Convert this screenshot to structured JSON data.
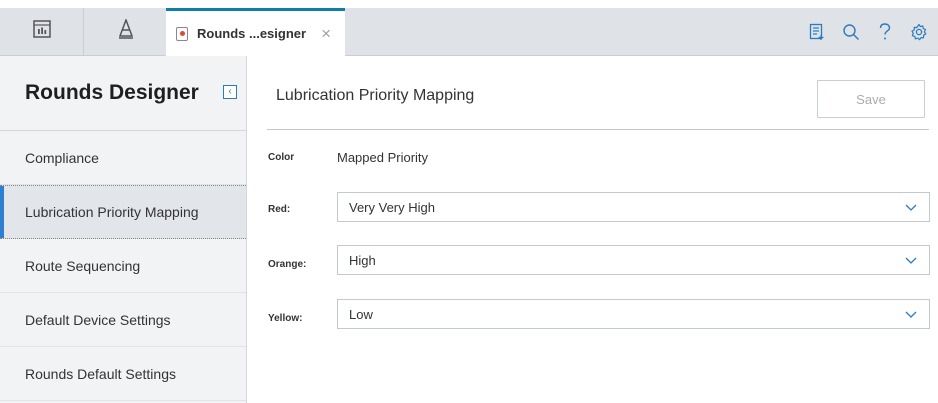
{
  "tabbar": {
    "tabs": [
      {
        "label": "Rounds ...esigner",
        "close": "×"
      }
    ],
    "icons": [
      "dashboard-icon",
      "hierarchy-icon",
      "document-icon",
      "clipboard-icon",
      "search-icon",
      "help-icon",
      "settings-icon"
    ]
  },
  "sidebar": {
    "title": "Rounds Designer",
    "items": [
      {
        "label": "Compliance",
        "active": false
      },
      {
        "label": "Lubrication Priority Mapping",
        "active": true
      },
      {
        "label": "Route Sequencing",
        "active": false
      },
      {
        "label": "Default Device Settings",
        "active": false
      },
      {
        "label": "Rounds Default Settings",
        "active": false
      }
    ]
  },
  "main": {
    "title": "Lubrication Priority Mapping",
    "save_label": "Save",
    "col_color": "Color",
    "col_priority": "Mapped Priority",
    "rows": [
      {
        "label": "Red:",
        "value": "Very Very High"
      },
      {
        "label": "Orange:",
        "value": "High"
      },
      {
        "label": "Yellow:",
        "value": "Low"
      }
    ]
  },
  "colors": {
    "accent": "#2f7fd0",
    "tab_active_border": "#0b7fa8",
    "tabbar_bg": "#dfe3e7",
    "sidebar_bg": "#f2f3f4"
  }
}
